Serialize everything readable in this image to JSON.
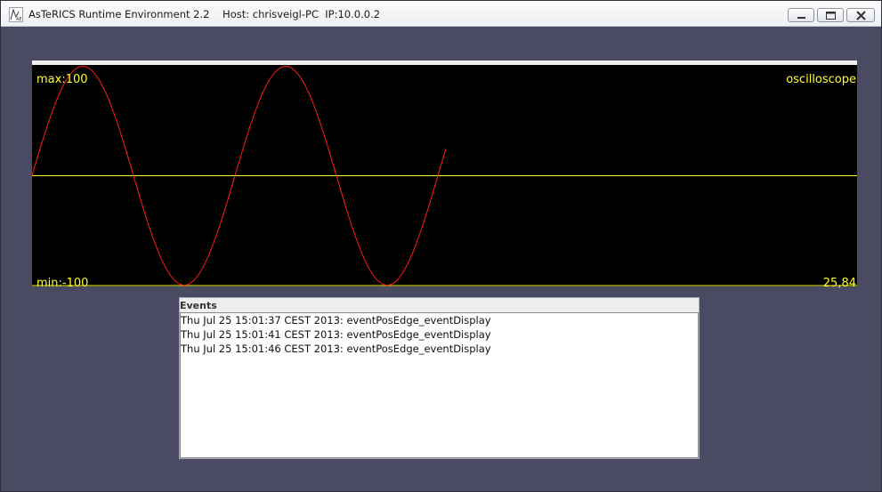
{
  "window": {
    "title": "AsTeRICS Runtime Environment 2.2    Host: chrisveigl-PC  IP:10.0.0.2",
    "icon": "asterics-app-icon",
    "controls": {
      "minimize": "minimize-icon",
      "maximize": "maximize-icon",
      "close": "close-icon"
    }
  },
  "oscilloscope": {
    "max_label": "max:100",
    "min_label": "min:-100",
    "name_label": "oscilloscope",
    "value_label": "25,84",
    "colors": {
      "background": "#000000",
      "trace": "#ff1a1a",
      "axis": "#ffff2a",
      "labels": "#ffff2a"
    }
  },
  "events": {
    "title": "Events",
    "items": [
      "Thu Jul 25 15:01:37 CEST 2013: eventPosEdge_eventDisplay",
      "Thu Jul 25 15:01:41 CEST 2013: eventPosEdge_eventDisplay",
      "Thu Jul 25 15:01:46 CEST 2013: eventPosEdge_eventDisplay"
    ]
  }
}
